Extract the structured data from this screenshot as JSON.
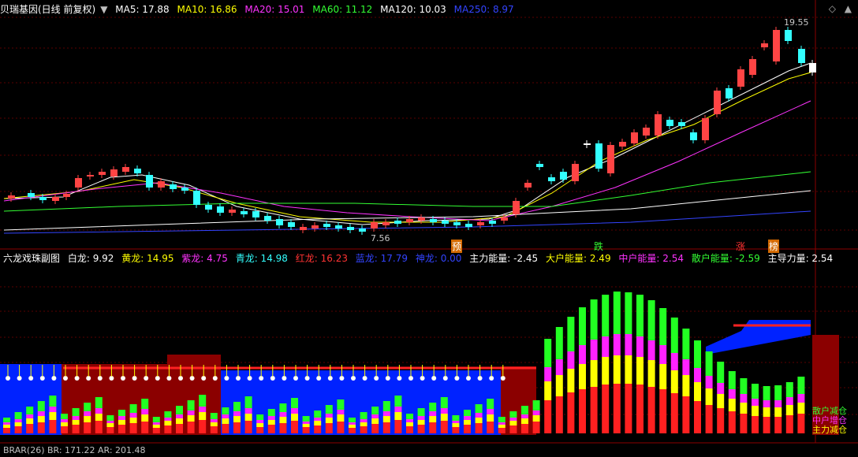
{
  "top_legend": {
    "title": "贝瑞基因(日线 前复权)",
    "items": [
      {
        "label": "MA5: 17.88",
        "color": "#ffffff"
      },
      {
        "label": "MA10: 16.86",
        "color": "#ffff00"
      },
      {
        "label": "MA20: 15.01",
        "color": "#ff33ff"
      },
      {
        "label": "MA60: 11.12",
        "color": "#33ff33"
      },
      {
        "label": "MA120: 10.03",
        "color": "#ffffff"
      },
      {
        "label": "MA250: 8.97",
        "color": "#3344ff"
      }
    ]
  },
  "price_annotations": {
    "high": "19.55",
    "low": "7.56"
  },
  "signal_tags": [
    {
      "text": "预",
      "color": "#ffffff",
      "bg": "#d46a00"
    },
    {
      "text": "跌",
      "color": "#33ff33",
      "bg": "#000000"
    },
    {
      "text": "涨",
      "color": "#ff3333",
      "bg": "#000000"
    },
    {
      "text": "榜",
      "color": "#ffffff",
      "bg": "#d46a00"
    }
  ],
  "sub_legend": {
    "title": "六龙戏珠副图",
    "items": [
      {
        "label": "白龙: 9.92",
        "color": "#ffffff"
      },
      {
        "label": "黄龙: 14.95",
        "color": "#ffff00"
      },
      {
        "label": "紫龙: 4.75",
        "color": "#ff33ff"
      },
      {
        "label": "青龙: 14.98",
        "color": "#33ffff"
      },
      {
        "label": "红龙: 16.23",
        "color": "#ff3333"
      },
      {
        "label": "蓝龙: 17.79",
        "color": "#3344ff"
      },
      {
        "label": "神龙: 0.00",
        "color": "#3344ff"
      },
      {
        "label": "主力能量: -2.45",
        "color": "#ffffff"
      },
      {
        "label": "大户能量: 2.49",
        "color": "#ffff00"
      },
      {
        "label": "中户能量: 2.54",
        "color": "#ff33ff"
      },
      {
        "label": "散户能量: -2.59",
        "color": "#33ff33"
      },
      {
        "label": "主导力量: 2.54",
        "color": "#ffffff"
      }
    ]
  },
  "side_labels": [
    {
      "text": "散户减仓",
      "color": "#33ff33"
    },
    {
      "text": "中户增仓",
      "color": "#ff33ff"
    },
    {
      "text": "主力减仓",
      "color": "#ffff00"
    }
  ],
  "bottom_legend": {
    "text": "BRAR(26) BR: 171.22 AR: 201.48"
  }
}
